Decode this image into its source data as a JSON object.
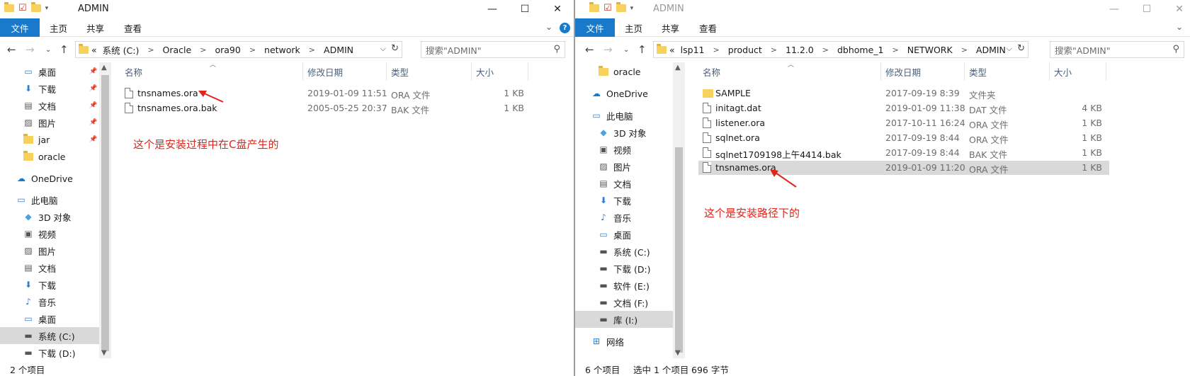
{
  "window_left": {
    "title": "ADMIN",
    "ribbon": {
      "file": "文件",
      "home": "主页",
      "share": "共享",
      "view": "查看"
    },
    "address": {
      "prefix": "«",
      "crumbs": [
        "系统 (C:)",
        "Oracle",
        "ora90",
        "network",
        "ADMIN"
      ]
    },
    "search_placeholder": "搜索\"ADMIN\"",
    "nav_items": [
      {
        "label": "桌面",
        "icon": "desktop-icon",
        "pinned": true
      },
      {
        "label": "下载",
        "icon": "download-icon",
        "pinned": true
      },
      {
        "label": "文档",
        "icon": "documents-icon",
        "pinned": true
      },
      {
        "label": "图片",
        "icon": "pictures-icon",
        "pinned": true
      },
      {
        "label": "jar",
        "icon": "folder-icon",
        "pinned": true
      },
      {
        "label": "oracle",
        "icon": "folder-icon",
        "pinned": false
      },
      {
        "label": "OneDrive",
        "icon": "onedrive-icon",
        "pinned": false
      },
      {
        "label": "此电脑",
        "icon": "this-pc-icon",
        "pinned": false
      },
      {
        "label": "3D 对象",
        "icon": "3d-objects-icon",
        "pinned": false
      },
      {
        "label": "视频",
        "icon": "videos-icon",
        "pinned": false
      },
      {
        "label": "图片",
        "icon": "pictures-icon",
        "pinned": false
      },
      {
        "label": "文档",
        "icon": "documents-icon",
        "pinned": false
      },
      {
        "label": "下载",
        "icon": "download-icon",
        "pinned": false
      },
      {
        "label": "音乐",
        "icon": "music-icon",
        "pinned": false
      },
      {
        "label": "桌面",
        "icon": "desktop-icon",
        "pinned": false
      },
      {
        "label": "系统 (C:)",
        "icon": "drive-icon",
        "pinned": false
      },
      {
        "label": "下载 (D:)",
        "icon": "drive-icon",
        "pinned": false
      }
    ],
    "columns": {
      "name": "名称",
      "date": "修改日期",
      "type": "类型",
      "size": "大小"
    },
    "files": [
      {
        "name": "tnsnames.ora",
        "date": "2019-01-09 11:51",
        "type": "ORA 文件",
        "size": "1 KB"
      },
      {
        "name": "tnsnames.ora.bak",
        "date": "2005-05-25 20:37",
        "type": "BAK 文件",
        "size": "1 KB"
      }
    ],
    "annotation": "这个是安装过程中在C盘产生的",
    "status": "2 个项目"
  },
  "window_right": {
    "title": "ADMIN",
    "ribbon": {
      "file": "文件",
      "home": "主页",
      "share": "共享",
      "view": "查看"
    },
    "address": {
      "prefix": "«",
      "crumbs": [
        "lsp11",
        "product",
        "11.2.0",
        "dbhome_1",
        "NETWORK",
        "ADMIN"
      ]
    },
    "search_placeholder": "搜索\"ADMIN\"",
    "nav_items": [
      {
        "label": "oracle",
        "icon": "folder-icon"
      },
      {
        "label": "OneDrive",
        "icon": "onedrive-icon"
      },
      {
        "label": "此电脑",
        "icon": "this-pc-icon"
      },
      {
        "label": "3D 对象",
        "icon": "3d-objects-icon"
      },
      {
        "label": "视频",
        "icon": "videos-icon"
      },
      {
        "label": "图片",
        "icon": "pictures-icon"
      },
      {
        "label": "文档",
        "icon": "documents-icon"
      },
      {
        "label": "下载",
        "icon": "download-icon"
      },
      {
        "label": "音乐",
        "icon": "music-icon"
      },
      {
        "label": "桌面",
        "icon": "desktop-icon"
      },
      {
        "label": "系统 (C:)",
        "icon": "drive-icon"
      },
      {
        "label": "下载 (D:)",
        "icon": "drive-icon"
      },
      {
        "label": "软件 (E:)",
        "icon": "drive-icon"
      },
      {
        "label": "文档 (F:)",
        "icon": "drive-icon"
      },
      {
        "label": "库 (I:)",
        "icon": "drive-icon"
      },
      {
        "label": "网络",
        "icon": "network-icon"
      }
    ],
    "columns": {
      "name": "名称",
      "date": "修改日期",
      "type": "类型",
      "size": "大小"
    },
    "files": [
      {
        "name": "SAMPLE",
        "date": "2017-09-19 8:39",
        "type": "文件夹",
        "size": "",
        "is_folder": true
      },
      {
        "name": "initagt.dat",
        "date": "2019-01-09 11:38",
        "type": "DAT 文件",
        "size": "4 KB"
      },
      {
        "name": "listener.ora",
        "date": "2017-10-11 16:24",
        "type": "ORA 文件",
        "size": "1 KB"
      },
      {
        "name": "sqlnet.ora",
        "date": "2017-09-19 8:44",
        "type": "ORA 文件",
        "size": "1 KB"
      },
      {
        "name": "sqlnet1709198上午4414.bak",
        "date": "2017-09-19 8:44",
        "type": "BAK 文件",
        "size": "1 KB"
      },
      {
        "name": "tnsnames.ora",
        "date": "2019-01-09 11:20",
        "type": "ORA 文件",
        "size": "1 KB"
      }
    ],
    "annotation": "这个是安装路径下的",
    "status": {
      "count": "6 个项目",
      "selected": "选中 1 个项目",
      "bytes": "696 字节"
    }
  },
  "colors": {
    "accent": "#1979ca",
    "annotation": "#e1241b",
    "selection": "#d9d9d9"
  }
}
